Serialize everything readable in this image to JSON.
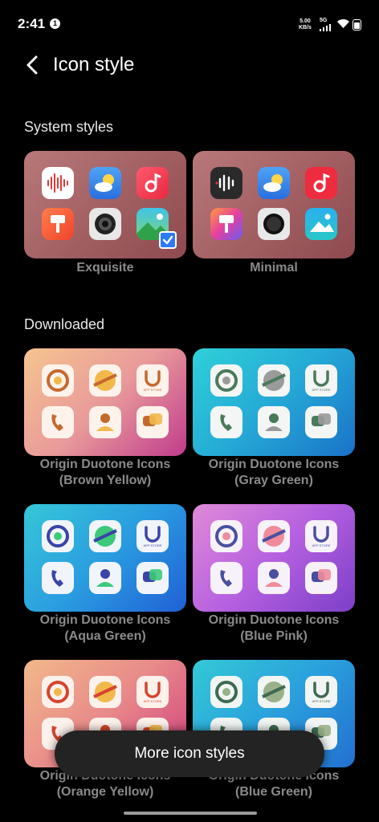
{
  "status_bar": {
    "time": "2:41",
    "notification_badge": "1",
    "net_speed_value": "5.00",
    "net_speed_unit": "KB/s",
    "network_type": "5G"
  },
  "header": {
    "title": "Icon style"
  },
  "system_styles": {
    "section_title": "System styles",
    "items": [
      {
        "label": "Exquisite",
        "selected": true
      },
      {
        "label": "Minimal",
        "selected": false
      }
    ]
  },
  "downloaded": {
    "section_title": "Downloaded",
    "items": [
      {
        "label_line1": "Origin Duotone Icons",
        "label_line2": "(Brown Yellow)"
      },
      {
        "label_line1": "Origin Duotone Icons",
        "label_line2": "(Gray Green)"
      },
      {
        "label_line1": "Origin Duotone Icons",
        "label_line2": "(Aqua Green)"
      },
      {
        "label_line1": "Origin Duotone Icons",
        "label_line2": "(Blue Pink)"
      },
      {
        "label_line1": "Origin Duotone Icons",
        "label_line2": "(Orange Yellow)"
      },
      {
        "label_line1": "Origin Duotone Icons",
        "label_line2": "(Blue Green)"
      }
    ],
    "app_store_icon_text": "APP STORE"
  },
  "more_button": {
    "label": "More icon styles"
  },
  "colors": {
    "accent": "#2d7cf6",
    "background": "#000000"
  }
}
